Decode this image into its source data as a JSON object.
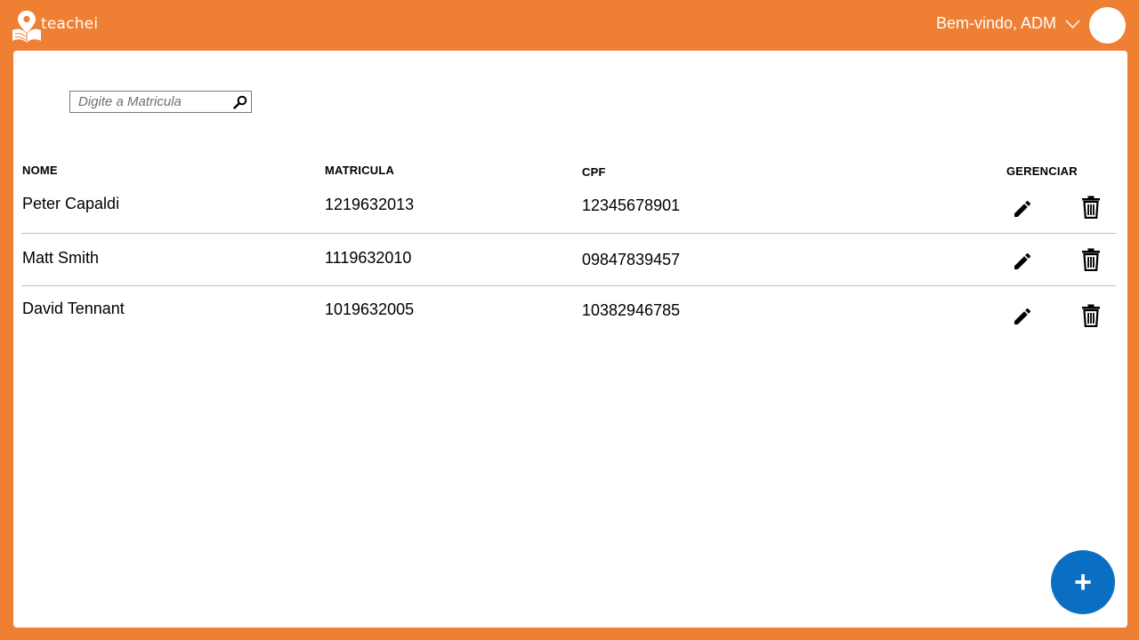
{
  "brand": {
    "name": "teachei"
  },
  "header": {
    "greeting": "Bem-vindo, ADM"
  },
  "search": {
    "placeholder": "Digite a Matricula",
    "value": ""
  },
  "table": {
    "columns": [
      "NOME",
      "MATRICULA",
      "CPF",
      "GERENCIAR"
    ],
    "rows": [
      {
        "nome": "Peter Capaldi",
        "matricula": "1219632013",
        "cpf": "12345678901"
      },
      {
        "nome": "Matt Smith",
        "matricula": "1119632010",
        "cpf": "09847839457"
      },
      {
        "nome": "David Tennant",
        "matricula": "1019632005",
        "cpf": "10382946785"
      }
    ]
  },
  "fab": {
    "label": "+"
  },
  "colors": {
    "brand_orange": "#ef7f33",
    "fab_blue": "#0a6fc2",
    "panel": "#ffffff"
  },
  "icons": [
    "logo-pin-book-icon",
    "chevron-down-icon",
    "search-icon",
    "edit-pencil-icon",
    "trash-icon",
    "plus-icon"
  ]
}
